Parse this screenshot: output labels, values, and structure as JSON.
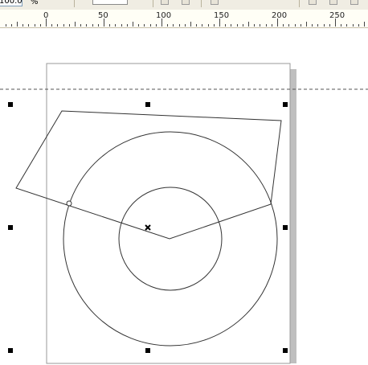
{
  "toolbar": {
    "zoom_value": "100.0",
    "zoom_unit": "%"
  },
  "ruler": {
    "labels": [
      "0",
      "50",
      "100",
      "150",
      "200",
      "250"
    ]
  },
  "icons": {
    "center": "center-mark-x",
    "node": "node-circle",
    "handle": "selection-handle-square"
  },
  "colors": {
    "toolbar_bg": "#f0ede3",
    "ruler_bg": "#fffef6",
    "shape_stroke": "#333333",
    "page_border": "#999999",
    "page_shadow": "#bfbfbf",
    "guide": "#555555"
  }
}
